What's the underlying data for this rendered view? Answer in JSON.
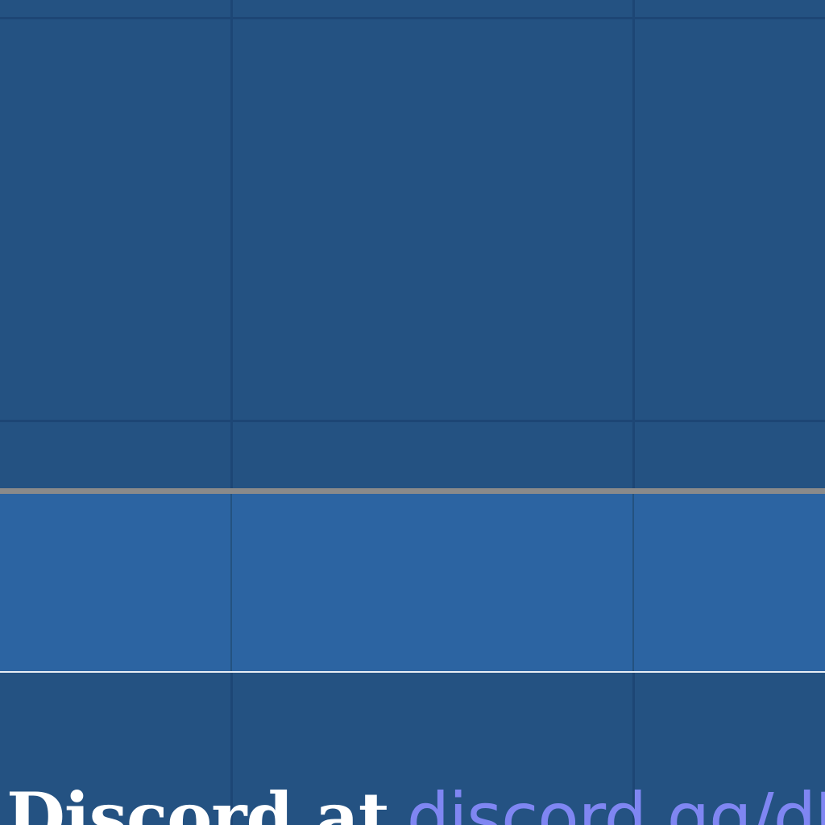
{
  "footer": {
    "text": "Discord at",
    "link_text": "discord.gg/dUI"
  },
  "colors": {
    "background": "#245282",
    "grid_line": "#1d4675",
    "selected_row": "#2c64a2",
    "separator": "#8a8a8a",
    "link": "#7f86f2"
  }
}
